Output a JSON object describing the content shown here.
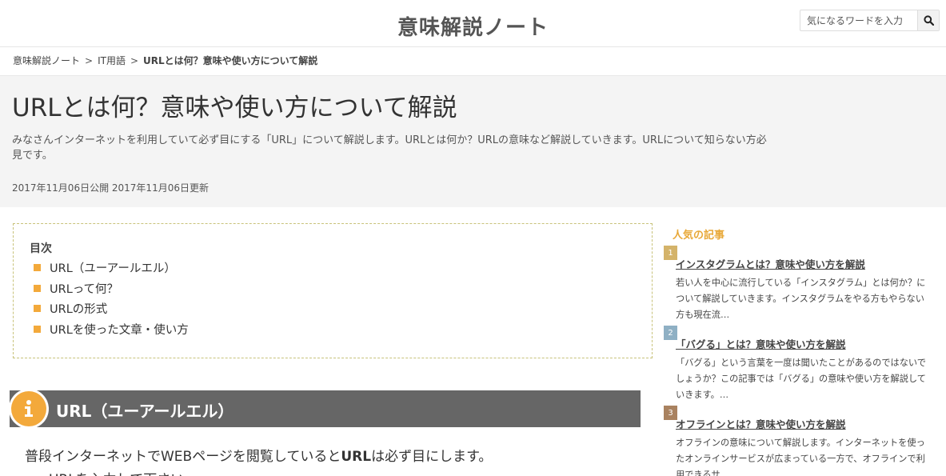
{
  "header": {
    "site_title": "意味解説ノート",
    "search_placeholder": "気になるワードを入力"
  },
  "breadcrumb": {
    "home": "意味解説ノート",
    "category": "IT用語",
    "current": "URLとは何？意味や使い方について解説",
    "separator": ">"
  },
  "article": {
    "title": "URLとは何？意味や使い方について解説",
    "lead": "みなさんインターネットを利用していて必ず目にする「URL」について解説します。URLとは何か？URLの意味など解説していきます。URLについて知らない方必見です。",
    "dates": "2017年11月06日公開 2017年11月06日更新"
  },
  "toc": {
    "title": "目次",
    "items": [
      "URL（ユーアールエル）",
      "URLって何？",
      "URLの形式",
      "URLを使った文章・使い方"
    ]
  },
  "section": {
    "heading": "URL（ユーアールエル）",
    "paragraph_before": "普段インターネットでWEBページを閲覧していると",
    "paragraph_bold": "URL",
    "paragraph_after": "は必ず目にします。",
    "paragraph_next": "URLを入力して下さい"
  },
  "sidebar": {
    "title": "人気の記事",
    "items": [
      {
        "rank": "1",
        "title": "インスタグラムとは？意味や使い方を解説",
        "desc": "若い人を中心に流行している「インスタグラム」とは何か？について解説していきます。インスタグラムをやる方もやらない方も現在流…"
      },
      {
        "rank": "2",
        "title": "「バグる」とは？意味や使い方を解説",
        "desc": "「バグる」という言葉を一度は聞いたことがあるのではないでしょうか？この記事では「バグる」の意味や使い方を解説していきます。…"
      },
      {
        "rank": "3",
        "title": "オフラインとは？意味や使い方を解説",
        "desc": "オフラインの意味について解説します。インターネットを使ったオンラインサービスが広まっている一方で、オフラインで利用できるサ…"
      }
    ]
  },
  "colors": {
    "accent": "#f3a93b",
    "sidebar_title": "#e8a838",
    "rank_1": "#d4b36a",
    "rank_2": "#8fb0c4",
    "rank_3": "#a98260",
    "heading_bg": "#666666"
  },
  "icons": {
    "search": "search-icon",
    "section": "info-icon"
  }
}
